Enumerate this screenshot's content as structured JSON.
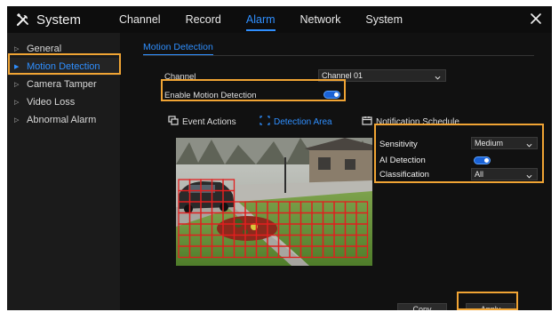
{
  "app": {
    "title": "System",
    "title_icon": "tools-icon"
  },
  "top_tabs": [
    {
      "label": "Channel",
      "active": false
    },
    {
      "label": "Record",
      "active": false
    },
    {
      "label": "Alarm",
      "active": true
    },
    {
      "label": "Network",
      "active": false
    },
    {
      "label": "System",
      "active": false
    }
  ],
  "sidebar": {
    "items": [
      {
        "label": "General",
        "active": false
      },
      {
        "label": "Motion Detection",
        "active": true
      },
      {
        "label": "Camera Tamper",
        "active": false
      },
      {
        "label": "Video Loss",
        "active": false
      },
      {
        "label": "Abnormal Alarm",
        "active": false
      }
    ]
  },
  "main": {
    "subtab": "Motion Detection",
    "channel": {
      "label": "Channel",
      "value": "Channel 01"
    },
    "enable": {
      "label": "Enable Motion Detection",
      "on": true
    },
    "tabs": [
      {
        "label": "Event Actions",
        "icon": "event-actions-icon",
        "active": false
      },
      {
        "label": "Detection Area",
        "icon": "detection-area-icon",
        "active": true
      },
      {
        "label": "Notification Schedule",
        "icon": "calendar-icon",
        "active": false
      }
    ],
    "settings": {
      "sensitivity": {
        "label": "Sensitivity",
        "value": "Medium"
      },
      "ai_detection": {
        "label": "AI Detection",
        "on": true
      },
      "classification": {
        "label": "Classification",
        "value": "All"
      }
    },
    "buttons": {
      "copy": "Copy",
      "apply": "Apply"
    }
  },
  "colors": {
    "accent": "#2f8fff",
    "highlight": "#f0a434",
    "grid": "#e02020",
    "background": "#161616"
  }
}
